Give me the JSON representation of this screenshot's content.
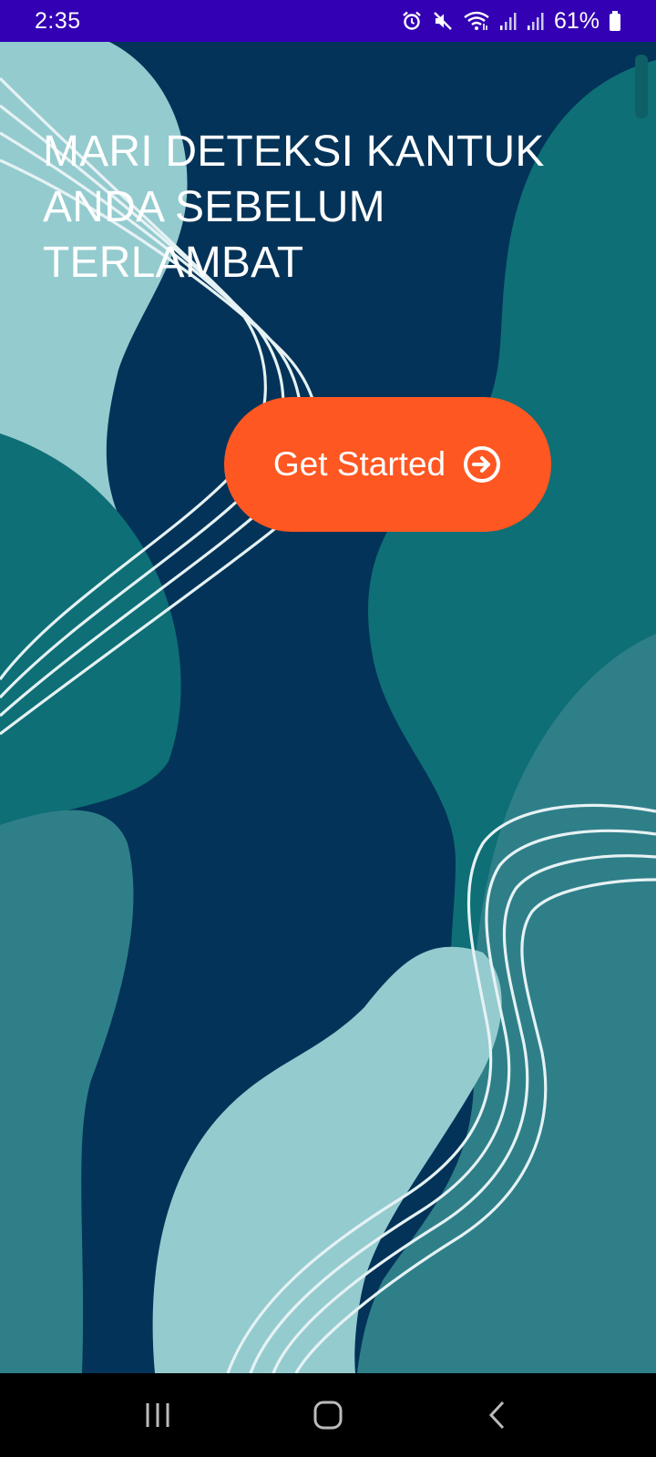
{
  "status_bar": {
    "time": "2:35",
    "battery": "61%",
    "background_color": "#3300b3",
    "icons": [
      "alarm-icon",
      "mute-icon",
      "wifi-icon",
      "signal-icon",
      "signal-icon",
      "battery-icon"
    ]
  },
  "main": {
    "headline": "MARI DETEKSI KANTUK ANDA SEBELUM TERLAMBAT",
    "button": {
      "label": "Get Started",
      "icon": "arrow-circle-right-icon",
      "color": "#ff5722"
    },
    "colors": {
      "navy": "#033358",
      "teal": "#0e6f76",
      "light_teal": "#94cbcf",
      "mid_teal": "#2f7f89"
    }
  },
  "nav_bar": {
    "buttons": [
      "recents-icon",
      "home-icon",
      "back-icon"
    ]
  }
}
